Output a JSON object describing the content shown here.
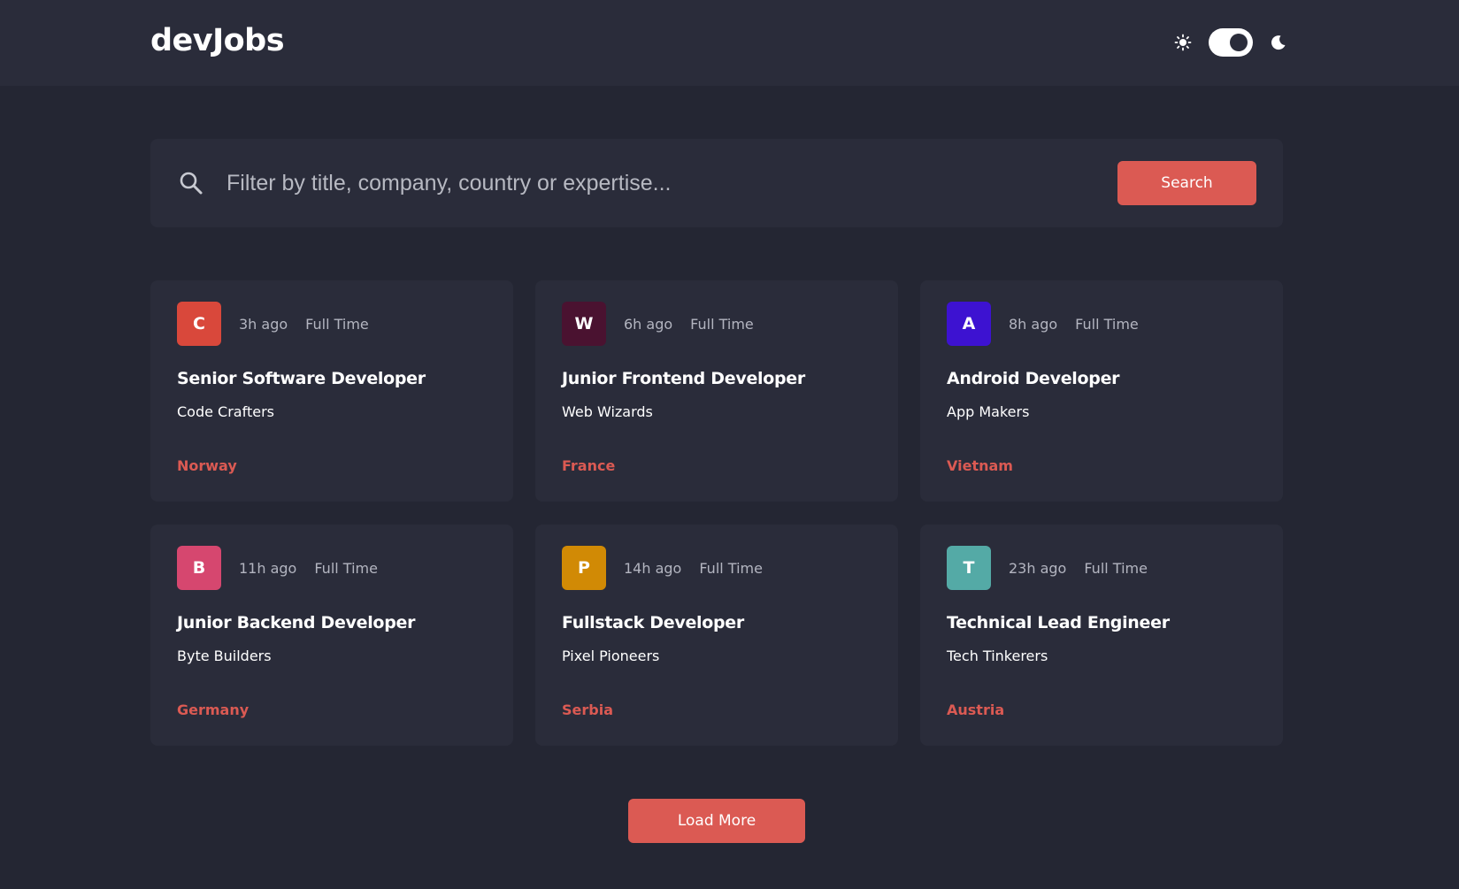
{
  "header": {
    "logo": "devJobs",
    "theme": {
      "light_icon": "sun-icon",
      "dark_icon": "moon-icon",
      "toggle_state": "dark"
    }
  },
  "search": {
    "placeholder": "Filter by title, company, country or expertise...",
    "value": "",
    "button_label": "Search"
  },
  "jobs": [
    {
      "logo_letter": "C",
      "logo_color": "#d9483b",
      "posted": "3h ago",
      "contract": "Full Time",
      "title": "Senior Software Developer",
      "company": "Code Crafters",
      "location": "Norway"
    },
    {
      "logo_letter": "W",
      "logo_color": "#4a1230",
      "posted": "6h ago",
      "contract": "Full Time",
      "title": "Junior Frontend Developer",
      "company": "Web Wizards",
      "location": "France"
    },
    {
      "logo_letter": "A",
      "logo_color": "#3d12d1",
      "posted": "8h ago",
      "contract": "Full Time",
      "title": "Android Developer",
      "company": "App Makers",
      "location": "Vietnam"
    },
    {
      "logo_letter": "B",
      "logo_color": "#d6476f",
      "posted": "11h ago",
      "contract": "Full Time",
      "title": "Junior Backend Developer",
      "company": "Byte Builders",
      "location": "Germany"
    },
    {
      "logo_letter": "P",
      "logo_color": "#d18a05",
      "posted": "14h ago",
      "contract": "Full Time",
      "title": "Fullstack Developer",
      "company": "Pixel Pioneers",
      "location": "Serbia"
    },
    {
      "logo_letter": "T",
      "logo_color": "#54aaa6",
      "posted": "23h ago",
      "contract": "Full Time",
      "title": "Technical Lead Engineer",
      "company": "Tech Tinkerers",
      "location": "Austria"
    }
  ],
  "load_more_label": "Load More"
}
